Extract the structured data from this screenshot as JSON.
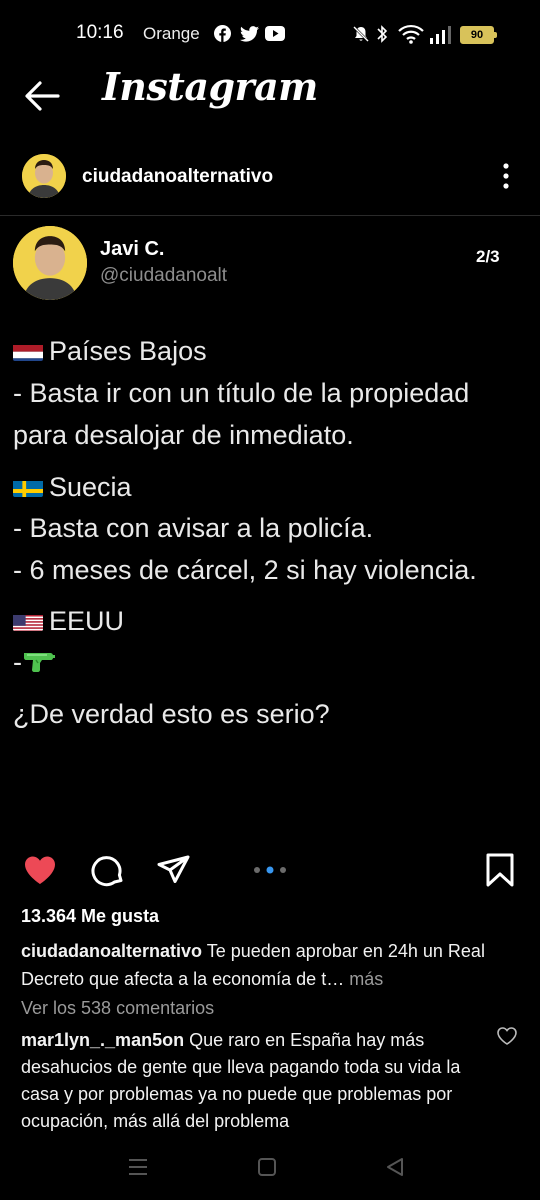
{
  "status_bar": {
    "time": "10:16",
    "carrier": "Orange",
    "battery": "90"
  },
  "header": {
    "brand": "Instagram"
  },
  "post": {
    "username": "ciudadanoalternativo",
    "tweet": {
      "name": "Javi C.",
      "handle": "@ciudadanoalt",
      "pager": "2/3",
      "lines": [
        "Países Bajos",
        "- Basta ir con un título de la propiedad",
        "para desalojar de inmediato.",
        "Suecia",
        "- Basta con avisar a la policía.",
        "- 6 meses de cárcel, 2 si hay violencia.",
        "EEUU",
        "-",
        "¿De verdad esto es serio?"
      ]
    },
    "likes": "13.364 Me gusta",
    "caption_user": "ciudadanoalternativo",
    "caption_text": " Te pueden aprobar en 24h un Real Decreto que afecta a la economía de t…",
    "caption_more": " más",
    "view_comments": "Ver los 538 comentarios",
    "comment_user": "mar1lyn_._man5on",
    "comment_text": " Que raro en España hay más desahucios de gente que lleva pagando toda su vida la casa y por problemas ya no puede que problemas por ocupación, más allá del problema"
  },
  "colors": {
    "background": "#000000",
    "like_red": "#ed4956",
    "avatar_yellow": "#f1d24b",
    "muted_text": "#9a9a9a",
    "carousel_active": "#3897f0"
  },
  "icons": [
    "back-arrow-icon",
    "more-vertical-icon",
    "heart-icon",
    "comment-icon",
    "share-icon",
    "bookmark-icon",
    "water-gun-icon"
  ]
}
